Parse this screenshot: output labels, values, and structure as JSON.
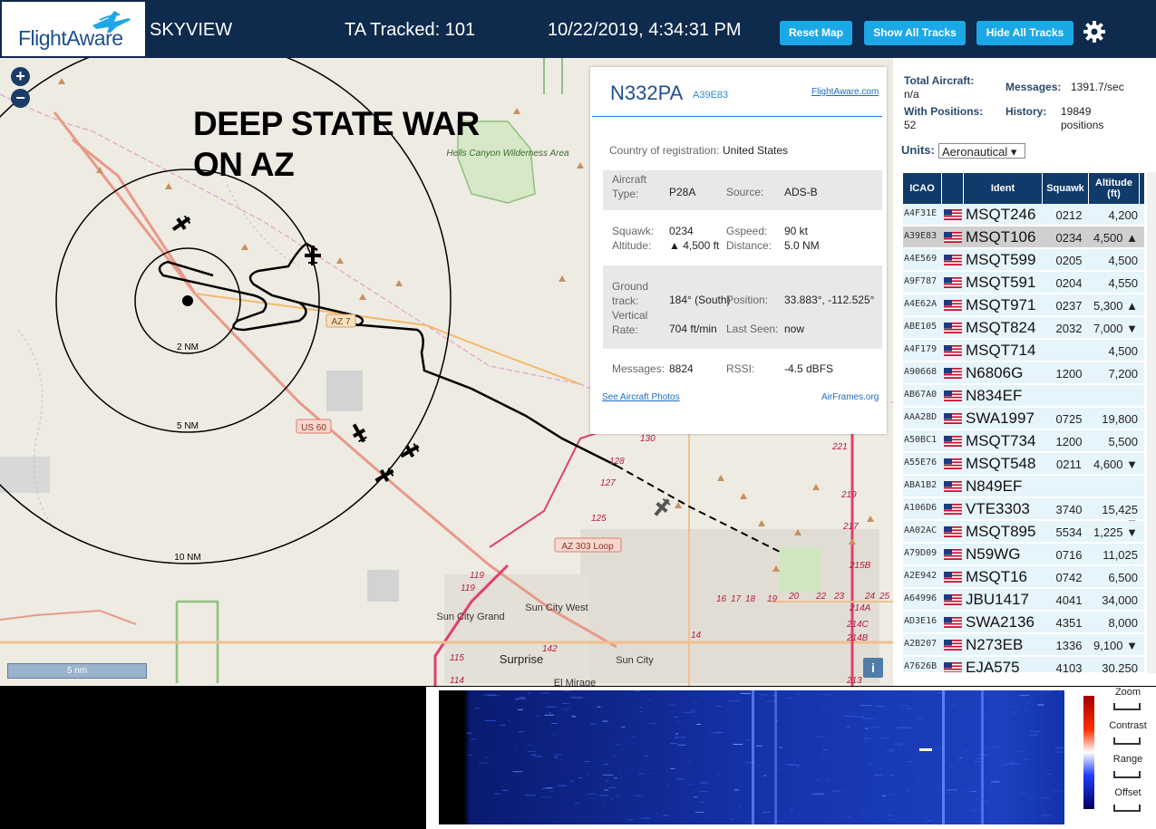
{
  "header": {
    "logo_text": "FlightAware",
    "app_title": "SKYVIEW",
    "tracked": "TA Tracked: 101",
    "datetime": "10/22/2019, 4:34:31 PM",
    "buttons": {
      "reset_map": "Reset Map",
      "show_all": "Show All Tracks",
      "hide_all": "Hide All Tracks"
    },
    "colors": {
      "bar": "#0e2a4c",
      "button": "#1ca8e6"
    }
  },
  "map": {
    "overlay_text": "DEEP STATE WAR ON AZ",
    "range_labels": [
      "2 NM",
      "5 NM",
      "10 NM"
    ],
    "scale_label": "5 nm",
    "zoom_in": "+",
    "zoom_out": "−",
    "info_button": "i",
    "labels": {
      "hells_canyon": "Hells Canyon Wilderness Area",
      "us60": "US 60",
      "az303": "AZ 303 Loop",
      "az74": "AZ 7",
      "sun_city_west": "Sun City West",
      "sun_city_grand": "Sun City Grand",
      "surprise": "Surprise",
      "sun_city": "Sun City",
      "el_mirage": "El Mirage"
    },
    "exit_numbers": [
      "119",
      "119",
      "115",
      "114",
      "125",
      "127",
      "128",
      "130",
      "142",
      "14",
      "16",
      "17",
      "18",
      "19",
      "20",
      "22",
      "23",
      "24",
      "25",
      "215B",
      "214A",
      "214B",
      "214C",
      "213",
      "217",
      "219",
      "221"
    ]
  },
  "info_popup": {
    "registration": "N332PA",
    "icao": "A39E83",
    "fa_link": "FlightAware.com",
    "country_label": "Country of registration:",
    "country_value": "United States",
    "aircraft_type_label": "Aircraft Type:",
    "aircraft_type": "P28A",
    "source_label": "Source:",
    "source": "ADS-B",
    "squawk_label": "Squawk:",
    "squawk": "0234",
    "gspeed_label": "Gspeed:",
    "gspeed": "90 kt",
    "altitude_label": "Altitude:",
    "altitude": "▲ 4,500 ft",
    "distance_label": "Distance:",
    "distance": "5.0 NM",
    "ground_track_label": "Ground track:",
    "ground_track": "184° (South)",
    "position_label": "Position:",
    "position": "33.883°, -112.525°",
    "vertical_rate_label": "Vertical Rate:",
    "vertical_rate": "704 ft/min",
    "last_seen_label": "Last Seen:",
    "last_seen": "now",
    "messages_label": "Messages:",
    "messages": "8824",
    "rssi_label": "RSSI:",
    "rssi": "-4.5 dBFS",
    "photos_link": "See Aircraft Photos",
    "airframes_link": "AirFrames.org"
  },
  "stats": {
    "total_aircraft_label": "Total Aircraft:",
    "total_aircraft": "n/a",
    "messages_label": "Messages:",
    "messages": "1391.7/sec",
    "with_positions_label": "With Positions:",
    "with_positions": "52",
    "history_label": "History:",
    "history": "19849 positions",
    "units_label": "Units:",
    "units_value": "Aeronautical ▾"
  },
  "table": {
    "columns": [
      "ICAO",
      "",
      "Ident",
      "Squawk",
      "Altitude (ft)"
    ],
    "rows": [
      {
        "icao": "A4F31E",
        "ident": "MSQT246",
        "squawk": "0212",
        "alt": "4,200"
      },
      {
        "icao": "A39E83",
        "ident": "MSQT106",
        "squawk": "0234",
        "alt": "4,500 ▲",
        "selected": true
      },
      {
        "icao": "A4E569",
        "ident": "MSQT599",
        "squawk": "0205",
        "alt": "4,500"
      },
      {
        "icao": "A9F787",
        "ident": "MSQT591",
        "squawk": "0204",
        "alt": "4,550"
      },
      {
        "icao": "A4E62A",
        "ident": "MSQT971",
        "squawk": "0237",
        "alt": "5,300 ▲"
      },
      {
        "icao": "ABE105",
        "ident": "MSQT824",
        "squawk": "2032",
        "alt": "7,000 ▼"
      },
      {
        "icao": "A4F179",
        "ident": "MSQT714",
        "squawk": "",
        "alt": "4,500"
      },
      {
        "icao": "A90668",
        "ident": "N6806G",
        "squawk": "1200",
        "alt": "7,200"
      },
      {
        "icao": "AB67A0",
        "ident": "N834EF",
        "squawk": "",
        "alt": ""
      },
      {
        "icao": "AAA28D",
        "ident": "SWA1997",
        "squawk": "0725",
        "alt": "19,800 ▲"
      },
      {
        "icao": "A50BC1",
        "ident": "MSQT734",
        "squawk": "1200",
        "alt": "5,500"
      },
      {
        "icao": "A55E76",
        "ident": "MSQT548",
        "squawk": "0211",
        "alt": "4,600 ▼"
      },
      {
        "icao": "ABA1B2",
        "ident": "N849EF",
        "squawk": "",
        "alt": ""
      },
      {
        "icao": "A106D6",
        "ident": "VTE3303",
        "squawk": "3740",
        "alt": "15,425 ▼"
      },
      {
        "icao": "AA02AC",
        "ident": "MSQT895",
        "squawk": "5534",
        "alt": "1,225 ▼"
      },
      {
        "icao": "A79D09",
        "ident": "N59WG",
        "squawk": "0716",
        "alt": "11,025 ▲"
      },
      {
        "icao": "A2E942",
        "ident": "MSQT16",
        "squawk": "0742",
        "alt": "6,500"
      },
      {
        "icao": "A64996",
        "ident": "JBU1417",
        "squawk": "4041",
        "alt": "34,000"
      },
      {
        "icao": "AD3E16",
        "ident": "SWA2136",
        "squawk": "4351",
        "alt": "8,000"
      },
      {
        "icao": "A2B207",
        "ident": "N273EB",
        "squawk": "1336",
        "alt": "9,100 ▼"
      },
      {
        "icao": "A7626B",
        "ident": "EJA575",
        "squawk": "4103",
        "alt": "30,250 ▲"
      }
    ]
  },
  "waterfall": {
    "controls": [
      "Zoom",
      "Contrast",
      "Range",
      "Offset"
    ]
  }
}
